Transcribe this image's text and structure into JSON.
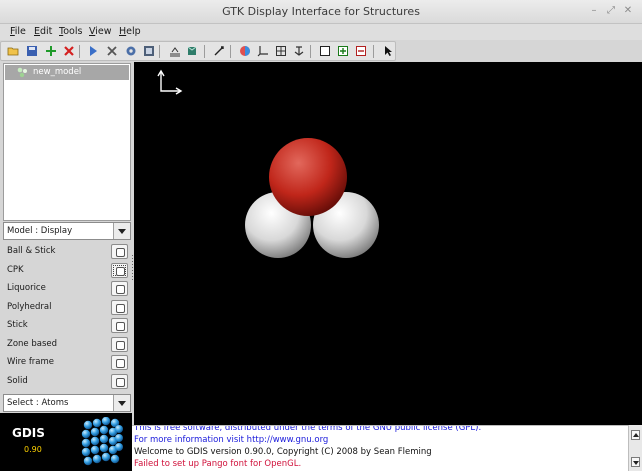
{
  "window": {
    "title": "GTK Display Interface for Structures",
    "controls": [
      "minimize-icon",
      "maximize-icon",
      "close-icon"
    ]
  },
  "menubar": {
    "items": [
      {
        "label": "File",
        "mnemonic": "F"
      },
      {
        "label": "Edit",
        "mnemonic": "E"
      },
      {
        "label": "Tools",
        "mnemonic": "T"
      },
      {
        "label": "View",
        "mnemonic": "V"
      },
      {
        "label": "Help",
        "mnemonic": "H"
      }
    ]
  },
  "toolbar": {
    "icons": [
      "open-folder-icon",
      "save-icon",
      "new-model-add-icon",
      "delete-model-icon",
      "play-animation-icon",
      "tools-icon",
      "settings-gear-icon",
      "task-icon",
      "energetics-icon",
      "diffraction-icon",
      "measure-icon",
      "render-surface-icon",
      "axes-icon",
      "cell-icon",
      "reset-view-icon",
      "single-pane-icon",
      "split-pane-icon",
      "close-pane-icon",
      "pointer-icon"
    ]
  },
  "model_tree": {
    "items": [
      {
        "label": "new_model",
        "selected": true
      }
    ]
  },
  "model_combo": {
    "value": "Model : Display"
  },
  "display_modes": [
    {
      "label": "Ball & Stick"
    },
    {
      "label": "CPK",
      "focused": true
    },
    {
      "label": "Liquorice"
    },
    {
      "label": "Polyhedral"
    },
    {
      "label": "Stick"
    },
    {
      "label": "Zone based"
    },
    {
      "label": "Wire frame"
    },
    {
      "label": "Solid"
    }
  ],
  "select_combo": {
    "value": "Select : Atoms"
  },
  "logo": {
    "name": "GDIS",
    "version": "0.90"
  },
  "console": {
    "lines": [
      {
        "text": "This is free software, distributed under the terms of the GNU public license (GPL).",
        "color": "#1a1adb"
      },
      {
        "text": "For more information visit http://www.gnu.org",
        "color": "#1a1adb"
      },
      {
        "text": "Welcome to GDIS version 0.90.0, Copyright (C) 2008 by Sean Fleming",
        "color": "#111111"
      },
      {
        "text": "Failed to set up Pango font for OpenGL.",
        "color": "#d0103a"
      }
    ]
  },
  "viewport": {
    "background": "#000000",
    "atoms": [
      {
        "element": "O",
        "color": "#c0261a"
      },
      {
        "element": "H",
        "color": "#e8e8e8"
      },
      {
        "element": "H",
        "color": "#e8e8e8"
      }
    ]
  }
}
